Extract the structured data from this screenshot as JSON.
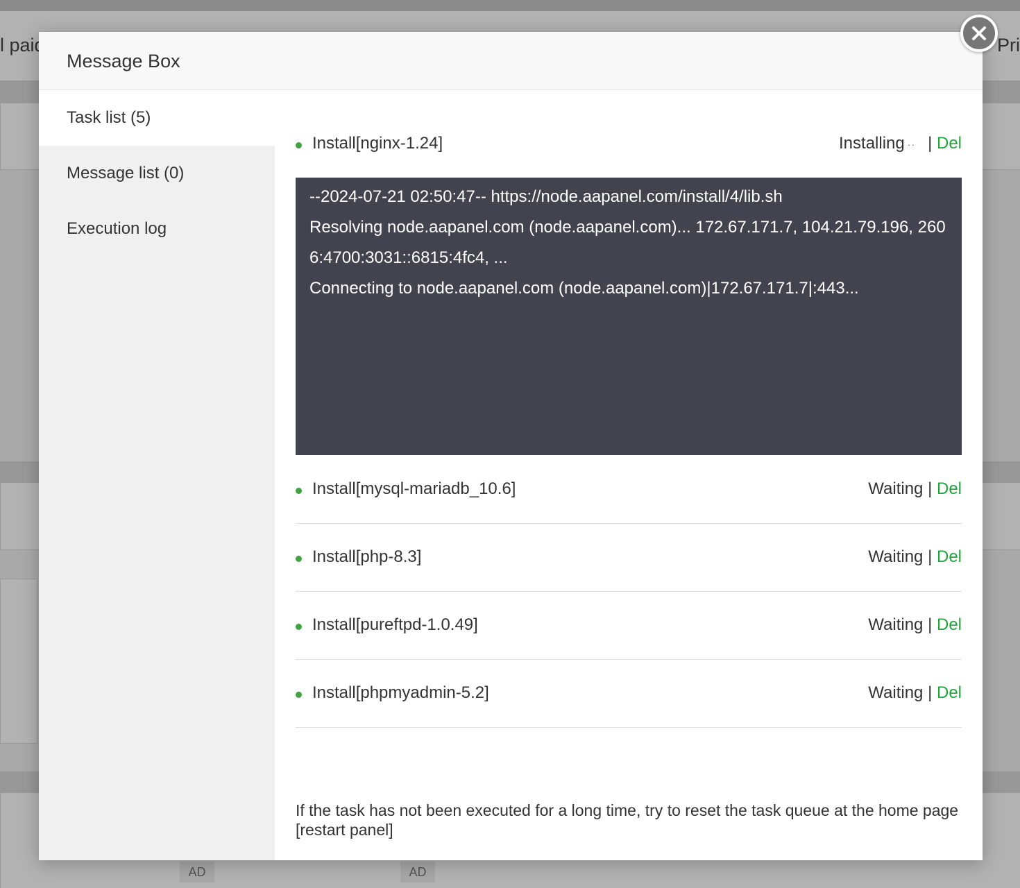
{
  "background": {
    "left_text": "l paid",
    "right_text": "Pri",
    "ad_label_1": "AD",
    "ad_label_2": "AD"
  },
  "modal": {
    "title": "Message Box",
    "close_icon": "close-icon"
  },
  "sidebar": {
    "items": [
      {
        "label": "Task list (5)",
        "active": true
      },
      {
        "label": "Message list (0)",
        "active": false
      },
      {
        "label": "Execution log",
        "active": false
      }
    ]
  },
  "tasks": [
    {
      "name": "Install[nginx-1.24]",
      "status": "Installing",
      "indicator": "··",
      "separator": "|",
      "action": "Del"
    },
    {
      "name": "Install[mysql-mariadb_10.6]",
      "status": "Waiting",
      "separator": "|",
      "action": "Del"
    },
    {
      "name": "Install[php-8.3]",
      "status": "Waiting",
      "separator": "|",
      "action": "Del"
    },
    {
      "name": "Install[pureftpd-1.0.49]",
      "status": "Waiting",
      "separator": "|",
      "action": "Del"
    },
    {
      "name": "Install[phpmyadmin-5.2]",
      "status": "Waiting",
      "separator": "|",
      "action": "Del"
    }
  ],
  "log": {
    "lines": [
      "--2024-07-21 02:50:47-- https://node.aapanel.com/install/4/lib.sh",
      "Resolving node.aapanel.com (node.aapanel.com)... 172.67.171.7, 104.21.79.196, 2606:4700:3031::6815:4fc4, ...",
      "Connecting to node.aapanel.com (node.aapanel.com)|172.67.171.7|:443..."
    ]
  },
  "footnote": "If the task has not been executed for a long time, try to reset the task queue at the home page [restart panel]",
  "colors": {
    "accent_green": "#20a53a",
    "dot_green": "#3fa33f",
    "log_background": "#43424f"
  }
}
